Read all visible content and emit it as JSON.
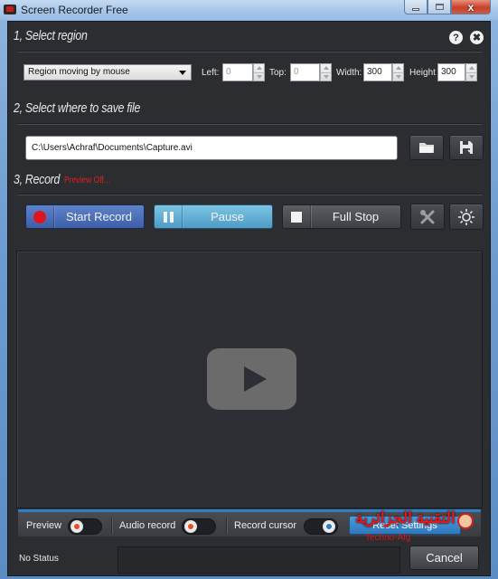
{
  "window": {
    "title": "Screen Recorder Free",
    "controls": {
      "minimize": "minimize",
      "maximize": "maximize",
      "close": "x"
    }
  },
  "header_icons": {
    "help": "?",
    "close": "✖"
  },
  "section1": {
    "title": "1, Select region",
    "region_mode": {
      "selected": "Region moving by mouse"
    },
    "fields": [
      {
        "label": "Left:",
        "value": "0"
      },
      {
        "label": "Top:",
        "value": "0"
      },
      {
        "label": "Width:",
        "value": "300"
      },
      {
        "label": "Height",
        "value": "300"
      }
    ]
  },
  "section2": {
    "title": "2, Select where to save file",
    "path": "C:\\Users\\Achraf\\Documents\\Capture.avi",
    "buttons": {
      "browse": "folder-icon",
      "save": "save-disk-icon"
    }
  },
  "section3": {
    "title": "3, Record",
    "preview_status": "Preview Off...",
    "buttons": {
      "start": "Start Record",
      "pause": "Pause",
      "stop": "Full Stop",
      "settings": "tools-icon",
      "brightness": "brightness-icon"
    }
  },
  "options": {
    "preview": {
      "label": "Preview",
      "on": false
    },
    "audio": {
      "label": "Audio record",
      "on": false
    },
    "cursor": {
      "label": "Record cursor",
      "on": true
    },
    "reset_label": "Reset Settings"
  },
  "watermark": {
    "arabic": "التقنية الجزائرية",
    "latin": "Techno-Alg"
  },
  "footer": {
    "status": "No Status",
    "cancel": "Cancel"
  },
  "colors": {
    "accent": "#2e7fc4",
    "record_red": "#e0141e",
    "preview_off_red": "#e0201c",
    "toggle_off_dot": "#e8501c"
  }
}
